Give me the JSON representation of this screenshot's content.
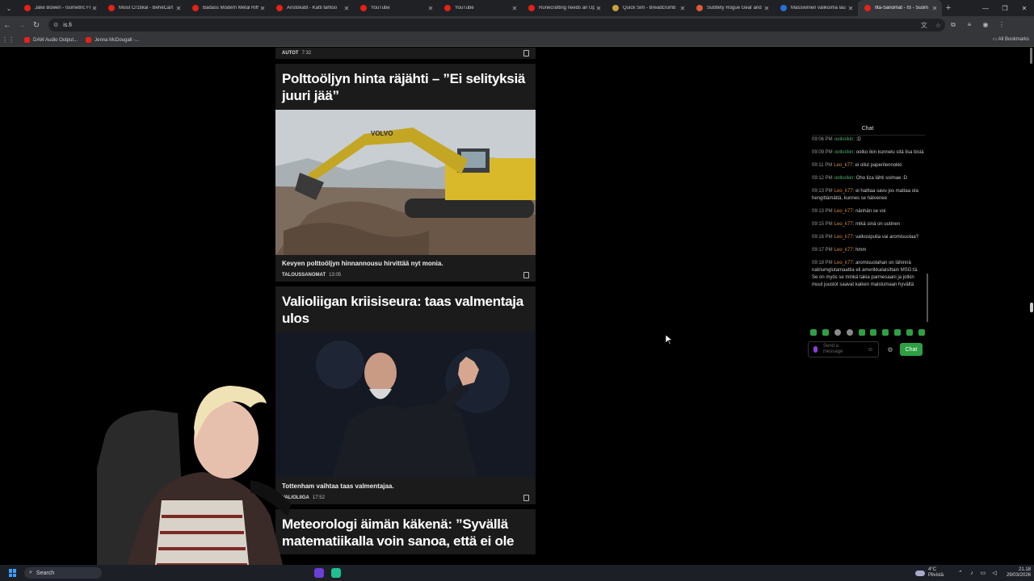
{
  "browser": {
    "tabs": [
      {
        "title": "Jake Bowen - Isometric Fl",
        "color": "#e62117"
      },
      {
        "title": "Moist Cr1tikal - BeheCart",
        "color": "#e62117"
      },
      {
        "title": "Badass Modern Metal Riff",
        "color": "#e62117"
      },
      {
        "title": "Aristokatit - Katti tahtoo",
        "color": "#e62117"
      },
      {
        "title": "YouTube",
        "color": "#e62117"
      },
      {
        "title": "YouTube",
        "color": "#e62117"
      },
      {
        "title": "Runecrafting needs an Up",
        "color": "#e62117"
      },
      {
        "title": "Quick Sim - Breadcrumb",
        "color": "#c8a13a"
      },
      {
        "title": "Subtlety Rogue Gear and",
        "color": "#e05a3a"
      },
      {
        "title": "Massiivinen valikoima lau",
        "color": "#2a6fdb"
      },
      {
        "title": "Ilta-Sanomat - IS - Suom",
        "color": "#e62117",
        "active": true
      }
    ],
    "url": "is.fi",
    "bookmarks": [
      {
        "label": "DAW Audio Output..."
      },
      {
        "label": "Jenna McDougall -..."
      }
    ],
    "all_bookmarks": "All Bookmarks"
  },
  "feed": {
    "top_meta": {
      "source": "AUTOT",
      "time": "7:32"
    },
    "articles": [
      {
        "headline": "Polttoöljyn hinta räjähti – ”Ei selityksiä juuri jää”",
        "caption": "Kevyen polttoöljyn hinnannousu hirvittää nyt monia.",
        "source": "TALOUSSANOMAT",
        "time": "13:05",
        "image_text": "VOLVO"
      },
      {
        "headline": "Valioliigan kriisiseura: taas valmentaja ulos",
        "caption": "Tottenham vaihtaa taas valmentajaa.",
        "source": "VALIOLIIGA",
        "time": "17:52"
      },
      {
        "headline": "Meteorologi äimän käkenä: ”Syvällä matematiikalla voin sanoa, että ei ole"
      }
    ]
  },
  "chat": {
    "title": "Chat",
    "messages": [
      {
        "time": "09:06 PM",
        "user": "ootkolkin",
        "text": ":D",
        "color": "u1"
      },
      {
        "time": "09:09 PM",
        "user": "ootkolkin",
        "text": "ootko ikin kunnelu sitä lisa bisiä",
        "color": "u1"
      },
      {
        "time": "09:11 PM",
        "user": "Leo_k77",
        "text": "ei ollut paperilennokki",
        "color": "u2"
      },
      {
        "time": "09:12 PM",
        "user": "ootkolkin",
        "text": "Oho liza lähti soimae :D",
        "color": "u1"
      },
      {
        "time": "09:13 PM",
        "user": "Leo_k77",
        "text": "ei haittaa savu jos mattaa ola hengittämättä, kunnes se hälvenee",
        "color": "u2"
      },
      {
        "time": "09:13 PM",
        "user": "Leo_k77",
        "text": "nänhän se voi",
        "color": "u2"
      },
      {
        "time": "09:15 PM",
        "user": "Leo_k77",
        "text": "mikä sinä on uutinen",
        "color": "u2"
      },
      {
        "time": "09:16 PM",
        "user": "Leo_k77",
        "text": "valkosipulia vai aromisuolaa?",
        "color": "u2"
      },
      {
        "time": "09:17 PM",
        "user": "Leo_k77",
        "text": "hmm",
        "color": "u2"
      },
      {
        "time": "09:18 PM",
        "user": "Leo_k77",
        "text": "aromisuolahan on lähinnä natriumglutamaattia eli amerikkalaisittain MSG:tä. Se on myös se minkä takia parmesaani ja jotkin muut juustot saavat kaiken maistumaan hyvältä",
        "color": "u2"
      }
    ],
    "input_placeholder": "Send a message",
    "send_label": "Chat"
  },
  "taskbar": {
    "search_label": "Search",
    "weather_temp": "4°C",
    "weather_desc": "Pilvistä",
    "time": "21.18",
    "date": "29/03/2026"
  }
}
